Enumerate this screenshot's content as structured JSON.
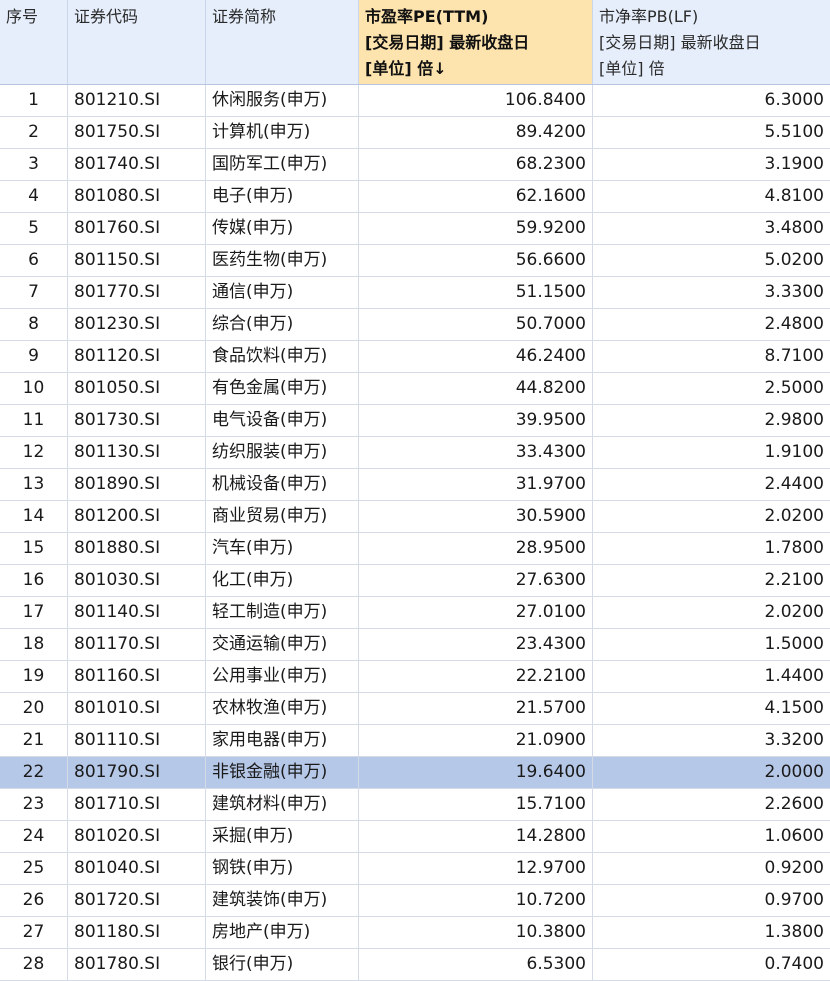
{
  "table": {
    "columns": [
      {
        "lines": [
          "序号"
        ]
      },
      {
        "lines": [
          "证券代码"
        ]
      },
      {
        "lines": [
          "证券简称"
        ]
      },
      {
        "lines": [
          "市盈率PE(TTM)",
          "[交易日期] 最新收盘日",
          "[单位] 倍↓"
        ]
      },
      {
        "lines": [
          "市净率PB(LF)",
          "[交易日期] 最新收盘日",
          "[单位] 倍"
        ]
      }
    ],
    "sorted_column": 3,
    "selected_row": 21,
    "rows": [
      {
        "no": "1",
        "code": "801210.SI",
        "name": "休闲服务(申万)",
        "pe": "106.8400",
        "pb": "6.3000"
      },
      {
        "no": "2",
        "code": "801750.SI",
        "name": "计算机(申万)",
        "pe": "89.4200",
        "pb": "5.5100"
      },
      {
        "no": "3",
        "code": "801740.SI",
        "name": "国防军工(申万)",
        "pe": "68.2300",
        "pb": "3.1900"
      },
      {
        "no": "4",
        "code": "801080.SI",
        "name": "电子(申万)",
        "pe": "62.1600",
        "pb": "4.8100"
      },
      {
        "no": "5",
        "code": "801760.SI",
        "name": "传媒(申万)",
        "pe": "59.9200",
        "pb": "3.4800"
      },
      {
        "no": "6",
        "code": "801150.SI",
        "name": "医药生物(申万)",
        "pe": "56.6600",
        "pb": "5.0200"
      },
      {
        "no": "7",
        "code": "801770.SI",
        "name": "通信(申万)",
        "pe": "51.1500",
        "pb": "3.3300"
      },
      {
        "no": "8",
        "code": "801230.SI",
        "name": "综合(申万)",
        "pe": "50.7000",
        "pb": "2.4800"
      },
      {
        "no": "9",
        "code": "801120.SI",
        "name": "食品饮料(申万)",
        "pe": "46.2400",
        "pb": "8.7100"
      },
      {
        "no": "10",
        "code": "801050.SI",
        "name": "有色金属(申万)",
        "pe": "44.8200",
        "pb": "2.5000"
      },
      {
        "no": "11",
        "code": "801730.SI",
        "name": "电气设备(申万)",
        "pe": "39.9500",
        "pb": "2.9800"
      },
      {
        "no": "12",
        "code": "801130.SI",
        "name": "纺织服装(申万)",
        "pe": "33.4300",
        "pb": "1.9100"
      },
      {
        "no": "13",
        "code": "801890.SI",
        "name": "机械设备(申万)",
        "pe": "31.9700",
        "pb": "2.4400"
      },
      {
        "no": "14",
        "code": "801200.SI",
        "name": "商业贸易(申万)",
        "pe": "30.5900",
        "pb": "2.0200"
      },
      {
        "no": "15",
        "code": "801880.SI",
        "name": "汽车(申万)",
        "pe": "28.9500",
        "pb": "1.7800"
      },
      {
        "no": "16",
        "code": "801030.SI",
        "name": "化工(申万)",
        "pe": "27.6300",
        "pb": "2.2100"
      },
      {
        "no": "17",
        "code": "801140.SI",
        "name": "轻工制造(申万)",
        "pe": "27.0100",
        "pb": "2.0200"
      },
      {
        "no": "18",
        "code": "801170.SI",
        "name": "交通运输(申万)",
        "pe": "23.4300",
        "pb": "1.5000"
      },
      {
        "no": "19",
        "code": "801160.SI",
        "name": "公用事业(申万)",
        "pe": "22.2100",
        "pb": "1.4400"
      },
      {
        "no": "20",
        "code": "801010.SI",
        "name": "农林牧渔(申万)",
        "pe": "21.5700",
        "pb": "4.1500"
      },
      {
        "no": "21",
        "code": "801110.SI",
        "name": "家用电器(申万)",
        "pe": "21.0900",
        "pb": "3.3200"
      },
      {
        "no": "22",
        "code": "801790.SI",
        "name": "非银金融(申万)",
        "pe": "19.6400",
        "pb": "2.0000"
      },
      {
        "no": "23",
        "code": "801710.SI",
        "name": "建筑材料(申万)",
        "pe": "15.7100",
        "pb": "2.2600"
      },
      {
        "no": "24",
        "code": "801020.SI",
        "name": "采掘(申万)",
        "pe": "14.2800",
        "pb": "1.0600"
      },
      {
        "no": "25",
        "code": "801040.SI",
        "name": "钢铁(申万)",
        "pe": "12.9700",
        "pb": "0.9200"
      },
      {
        "no": "26",
        "code": "801720.SI",
        "name": "建筑装饰(申万)",
        "pe": "10.7200",
        "pb": "0.9700"
      },
      {
        "no": "27",
        "code": "801180.SI",
        "name": "房地产(申万)",
        "pe": "10.3800",
        "pb": "1.3800"
      },
      {
        "no": "28",
        "code": "801780.SI",
        "name": "银行(申万)",
        "pe": "6.5300",
        "pb": "0.7400"
      }
    ]
  }
}
